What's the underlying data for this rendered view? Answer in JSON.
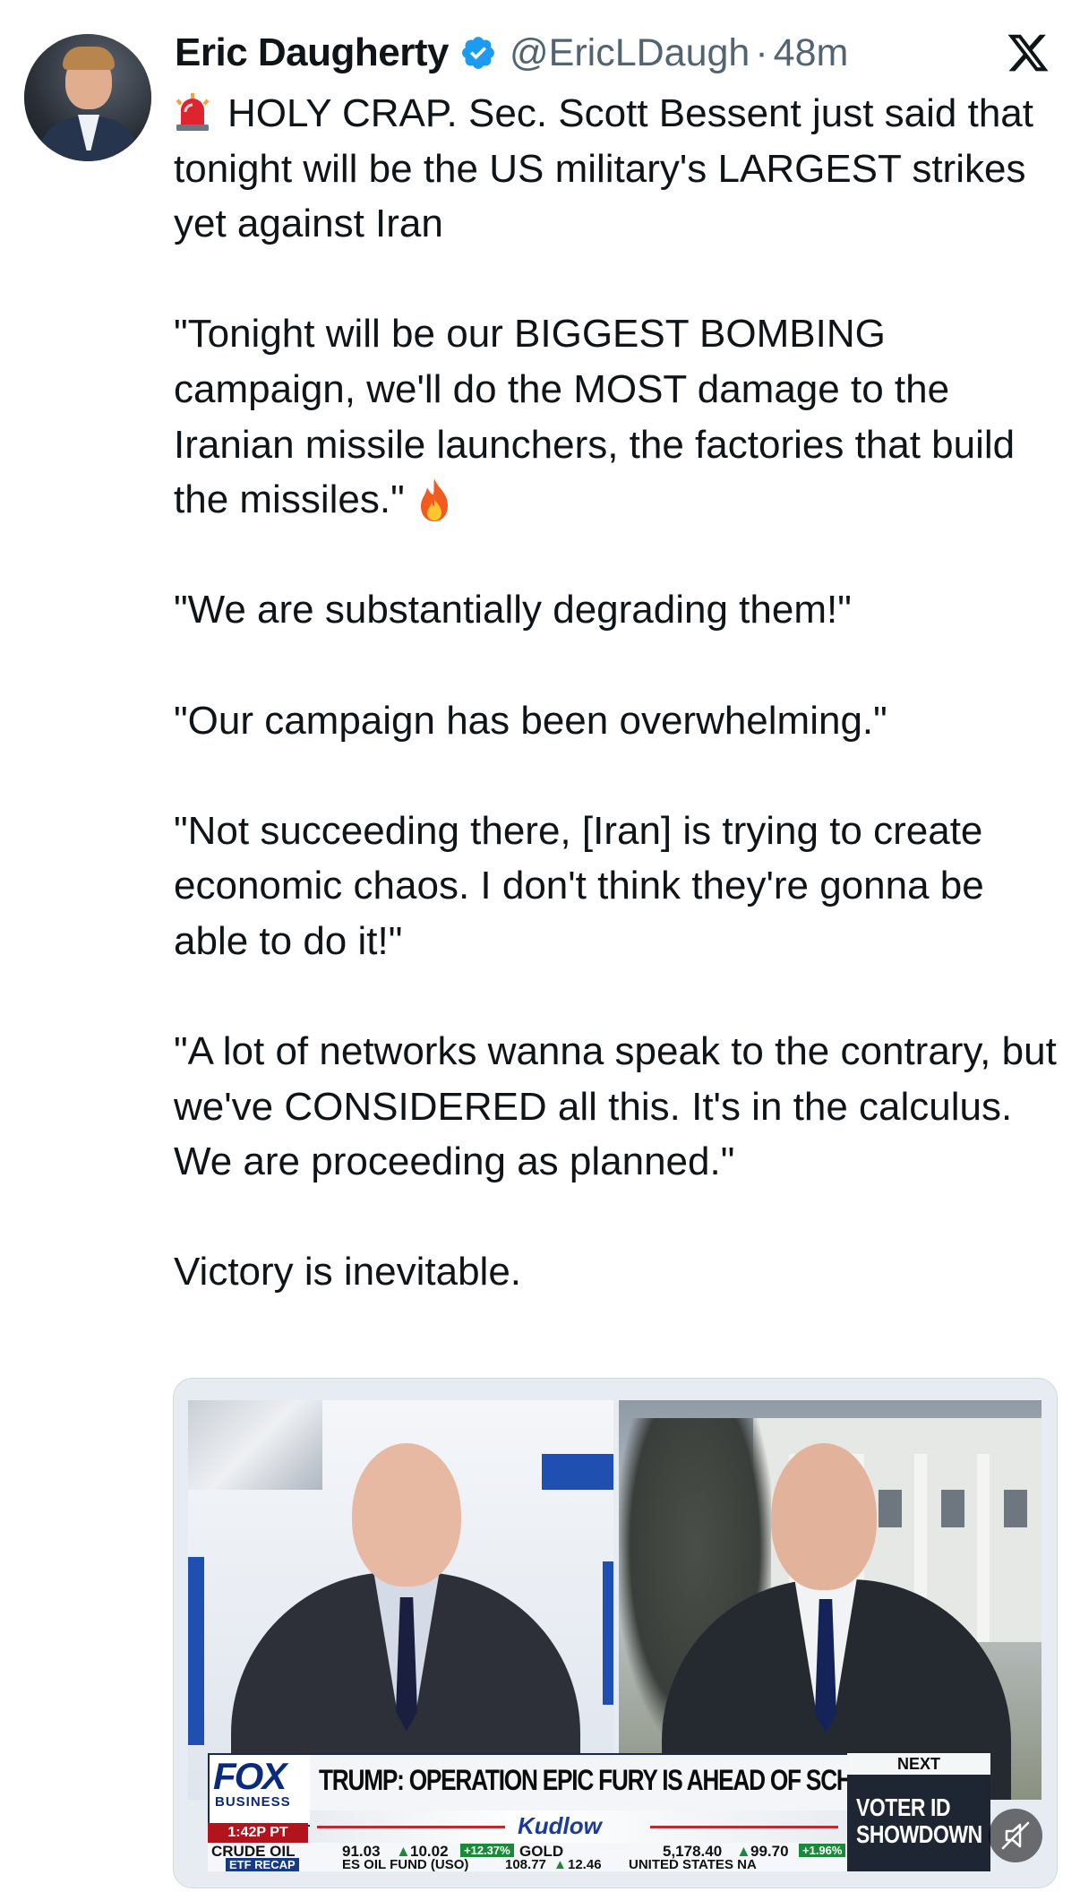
{
  "author": {
    "name": "Eric Daugherty",
    "handle": "@EricLDaugh",
    "separator": "·",
    "time_ago": "48m",
    "verified": true,
    "avatar_icon": "profile-photo"
  },
  "colors": {
    "text": "#0f1419",
    "secondary": "#536471",
    "verified_blue": "#1d9bf0"
  },
  "post": {
    "paragraphs": [
      "HOLY CRAP. Sec. Scott Bessent just said that tonight will be the US military's LARGEST strikes yet against Iran",
      "\"Tonight will be our BIGGEST BOMBING campaign, we'll do the MOST damage to the Iranian missile launchers, the factories that build the missiles.\"",
      "\"We are substantially degrading them!\"",
      "\"Our campaign has been overwhelming.\"",
      "\"Not succeeding there, [Iran] is trying to create economic chaos. I don't think they're gonna be able to do it!\"",
      "\"A lot of networks wanna speak to the contrary, but we've CONSIDERED all this. It's in the calculus. We are proceeding as planned.\"",
      "Victory is inevitable."
    ],
    "emoji_icons": [
      "siren-icon",
      "fire-icon"
    ]
  },
  "video": {
    "network": "FOX",
    "network_sub": "BUSINESS",
    "time": "1:42P PT",
    "headline": "TRUMP: OPERATION EPIC FURY IS AHEAD OF SCHEDULE",
    "show": "Kudlow",
    "next_label": "NEXT",
    "next_show": "VOTER ID SHOWDOWN",
    "ticker": {
      "crude_label": "CRUDE OIL",
      "crude_sub": "ETF RECAP",
      "crude_price": "91.03",
      "crude_change": "10.02",
      "crude_pct": "+12.37%",
      "gold_label": "GOLD",
      "gold_price": "5,178.40",
      "gold_change": "99.70",
      "gold_pct": "+1.96%",
      "fund_text": "ES OIL FUND (USO)",
      "fund_price": "108.77",
      "fund_change": "12.46",
      "fund_tail": "UNITED STATES NA"
    }
  }
}
